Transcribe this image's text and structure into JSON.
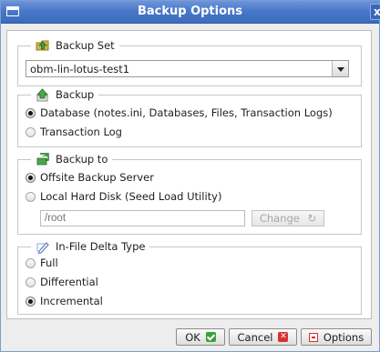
{
  "window": {
    "title": "Backup Options",
    "close_glyph": "x"
  },
  "backup_set": {
    "legend": "Backup Set",
    "icon": "backup-set-folder-icon",
    "selected": "obm-lin-lotus-test1"
  },
  "backup": {
    "legend": "Backup",
    "icon": "backup-upload-icon",
    "options": [
      {
        "label": "Database (notes.ini, Databases, Files, Transaction Logs)",
        "selected": true
      },
      {
        "label": "Transaction Log",
        "selected": false
      }
    ]
  },
  "backup_to": {
    "legend": "Backup to",
    "icon": "backup-destination-icon",
    "options": [
      {
        "label": "Offsite Backup Server",
        "selected": true
      },
      {
        "label": "Local Hard Disk (Seed Load Utility)",
        "selected": false
      }
    ],
    "path_placeholder": "/root",
    "change_label": "Change"
  },
  "delta": {
    "legend": "In-File Delta Type",
    "icon": "delta-pencil-icon",
    "options": [
      {
        "label": "Full",
        "selected": false
      },
      {
        "label": "Differential",
        "selected": false
      },
      {
        "label": "Incremental",
        "selected": true
      }
    ]
  },
  "footer": {
    "ok_label": "OK",
    "cancel_label": "Cancel",
    "options_label": "Options"
  },
  "colors": {
    "titlebar": "#4a78c8",
    "ok_icon": "#3aa23a",
    "cancel_icon": "#d83030"
  }
}
